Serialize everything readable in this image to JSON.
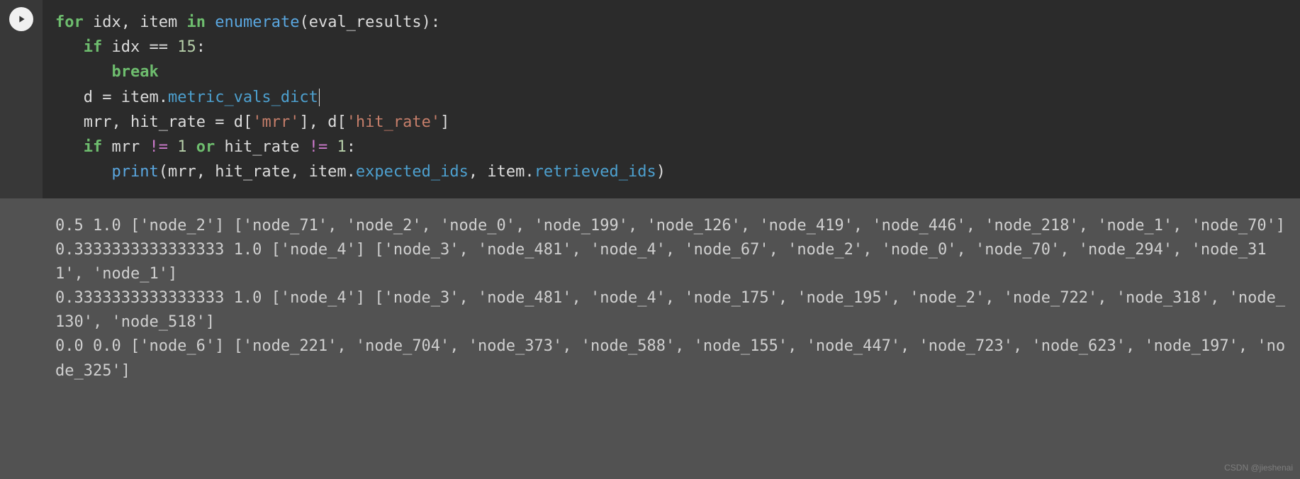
{
  "code": {
    "l1": {
      "for": "for",
      "idx": "idx",
      "item": "item",
      "in": "in",
      "enumerate": "enumerate",
      "eval_results": "eval_results"
    },
    "l2": {
      "if": "if",
      "idx": "idx",
      "eq": "==",
      "n15": "15"
    },
    "l3": {
      "break": "break"
    },
    "l4": {
      "d": "d",
      "eq": "=",
      "item": "item",
      "attr": "metric_vals_dict"
    },
    "l5": {
      "mrr": "mrr",
      "hit_rate": "hit_rate",
      "eq": "=",
      "d1": "d",
      "s_mrr": "'mrr'",
      "d2": "d",
      "s_hit": "'hit_rate'"
    },
    "l6": {
      "if": "if",
      "mrr": "mrr",
      "ne1": "!=",
      "one1": "1",
      "or": "or",
      "hit_rate": "hit_rate",
      "ne2": "!=",
      "one2": "1"
    },
    "l7": {
      "print": "print",
      "mrr": "mrr",
      "hit_rate": "hit_rate",
      "item1": "item",
      "attr1": "expected_ids",
      "item2": "item",
      "attr2": "retrieved_ids"
    }
  },
  "output_lines": [
    "0.5 1.0 ['node_2'] ['node_71', 'node_2', 'node_0', 'node_199', 'node_126', 'node_419', 'node_446', 'node_218', 'node_1', 'node_70']",
    "0.3333333333333333 1.0 ['node_4'] ['node_3', 'node_481', 'node_4', 'node_67', 'node_2', 'node_0', 'node_70', 'node_294', 'node_311', 'node_1']",
    "0.3333333333333333 1.0 ['node_4'] ['node_3', 'node_481', 'node_4', 'node_175', 'node_195', 'node_2', 'node_722', 'node_318', 'node_130', 'node_518']",
    "0.0 0.0 ['node_6'] ['node_221', 'node_704', 'node_373', 'node_588', 'node_155', 'node_447', 'node_723', 'node_623', 'node_197', 'node_325']"
  ],
  "watermark": "CSDN @jieshenai"
}
